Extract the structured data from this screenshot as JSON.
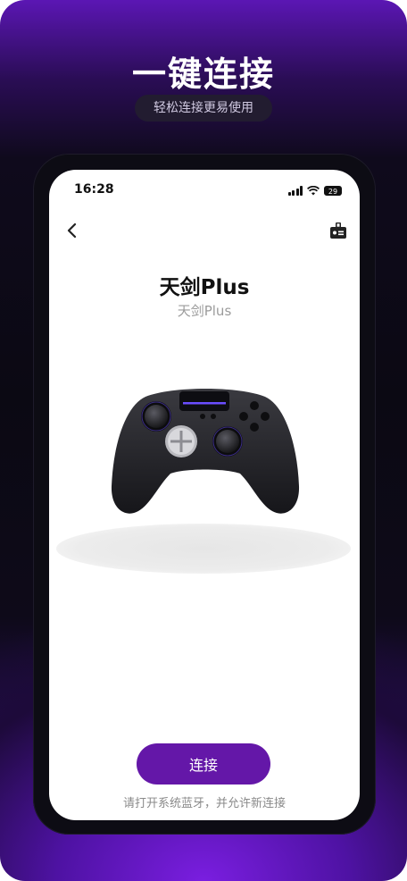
{
  "headline": "一键连接",
  "subheadline": "轻松连接更易使用",
  "status_bar": {
    "time": "16:28",
    "battery": "29"
  },
  "nav": {
    "back_icon": "chevron-left-icon",
    "support_icon": "customer-service-icon"
  },
  "device": {
    "title": "天剑Plus",
    "subtitle": "天剑Plus"
  },
  "connect_button": "连接",
  "hint": "请打开系统蓝牙，并允许新连接",
  "colors": {
    "accent": "#6417a8",
    "poster_bg": "#0b0913",
    "glow": "#7a1ee0"
  }
}
